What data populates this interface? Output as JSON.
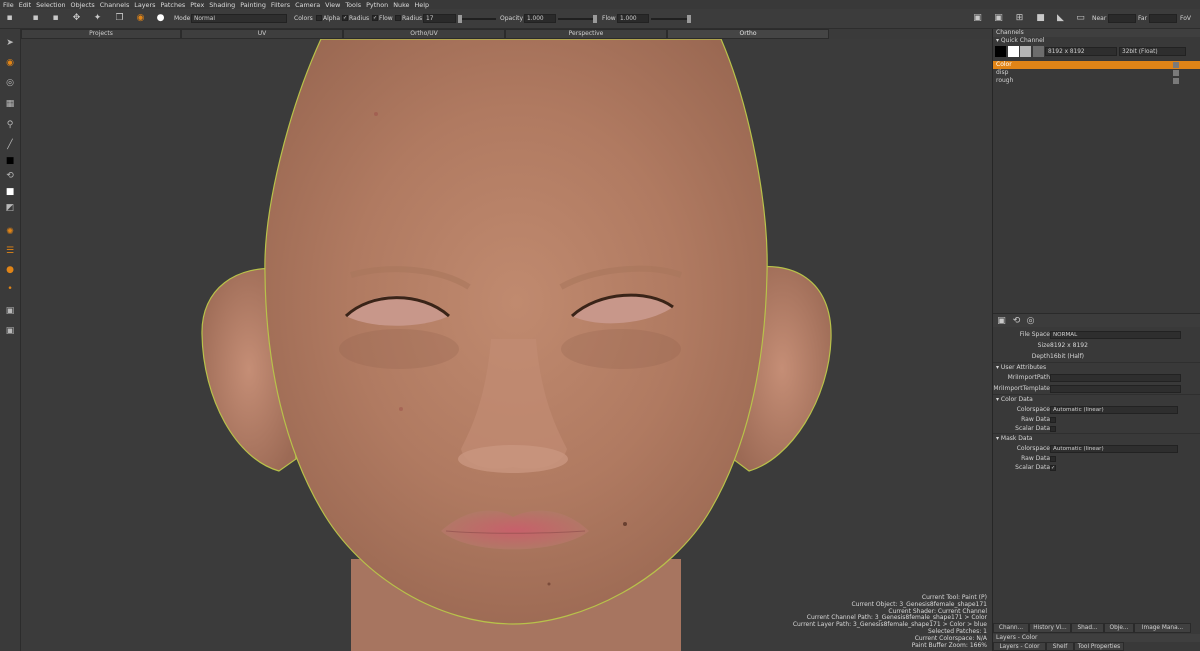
{
  "menu": [
    "File",
    "Edit",
    "Selection",
    "Objects",
    "Channels",
    "Layers",
    "Patches",
    "Ptex",
    "Shading",
    "Painting",
    "Filters",
    "Camera",
    "View",
    "Tools",
    "Python",
    "Nuke",
    "Help"
  ],
  "toolbar": {
    "mode_label": "Mode",
    "mode_value": "Normal",
    "colors_label": "Colors",
    "alpha_label": "Alpha",
    "radius_check_label": "Radius",
    "flow_check_label": "Flow",
    "radius_label": "Radius",
    "radius_value": "17",
    "opacity_label": "Opacity",
    "opacity_value": "1.000",
    "flow_label": "Flow",
    "flow_value": "1.000",
    "near_label": "Near",
    "far_label": "Far",
    "fov_label": "FoV"
  },
  "viewport_tabs": [
    "Projects",
    "UV",
    "Ortho/UV",
    "Perspective",
    "Ortho"
  ],
  "active_tab": "Ortho",
  "status_info": [
    "Current Tool: Paint (P)",
    "Current Object: 3_Genesis8female_shape171",
    "Current Shader: Current Channel",
    "Current Channel Path: 3_Genesis8female_shape171 > Color",
    "Current Layer Path: 3_Genesis8female_shape171 > Color > blue",
    "Selected Patches: 1",
    "Current Colorspace: N/A",
    "Paint Buffer Zoom: 166%"
  ],
  "channels_panel": {
    "title": "Channels",
    "quick_channel": "Quick Channel",
    "resolution": "8192 x 8192",
    "bit_depth": "32bit (Float)",
    "channels": [
      "Color",
      "disp",
      "rough"
    ],
    "selected_channel": "Color"
  },
  "properties": {
    "file_space_label": "File Space",
    "file_space_value": "NORMAL",
    "size_label": "Size",
    "size_value": "8192 x 8192",
    "depth_label": "Depth",
    "depth_value": "16bit (Half)",
    "user_attributes": "User Attributes",
    "mri_import_path": "MriImportPath",
    "mri_import_template": "MriImportTemplate",
    "color_data": "Color Data",
    "colorspace_label": "Colorspace",
    "colorspace_value": "Automatic (linear)",
    "raw_data_label": "Raw Data",
    "scalar_data_label": "Scalar Data",
    "mask_data": "Mask Data",
    "mask_colorspace_value": "Automatic (linear)"
  },
  "bottom_tabs": [
    "Chann...",
    "History Vi...",
    "Shad...",
    "Obje...",
    "Image Mana..."
  ],
  "layers_title": "Layers - Color",
  "bottom_tabs2": [
    "Layers - Color",
    "Shelf",
    "Tool Properties"
  ],
  "accent_color": "#e08417"
}
